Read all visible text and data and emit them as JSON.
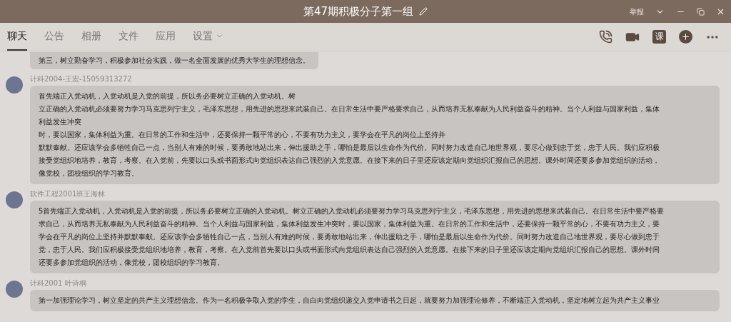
{
  "window": {
    "title": "第47期积极分子第一组",
    "report": "举报"
  },
  "tabs": [
    {
      "label": "聊天",
      "selected": true,
      "dropdown": false
    },
    {
      "label": "公告",
      "selected": false,
      "dropdown": false
    },
    {
      "label": "相册",
      "selected": false,
      "dropdown": false
    },
    {
      "label": "文件",
      "selected": false,
      "dropdown": false
    },
    {
      "label": "应用",
      "selected": false,
      "dropdown": false
    },
    {
      "label": "设置",
      "selected": false,
      "dropdown": true
    }
  ],
  "toolbar": {
    "lesson_label": "课"
  },
  "messages": [
    {
      "lines": [
        "第三，树立勤奋学习，积极参加社会实践，做一名全面发展的优秀大学生的理想信念。"
      ]
    },
    {
      "sender": "计科2004-王宏-15059313272",
      "lines": [
        "首先端正入党动机，入党动机是入党的前提，所以务必要树立正确的入党动机。树",
        "立正确的入党动机必须要努力学习马克思列宁主义，毛泽东思想，用先进的思想来武装自己。在日常生活中要严格要求自己，从而培养无私奉献为人民利益奋斗的精神。当个人利益与国家利益，集体",
        "利益发生冲突",
        "时，要以国家，集体利益为重。在日常的工作和生活中，还要保持一颗平常的心，不要有功力主义，要学会在平凡的岗位上坚持并",
        "默默奉献。还应该学会多牺牲自己一点，当别人有难的时候，要勇敢地站出来，伸出援助之手，哪怕是最后以生命作为代价。同时努力改造自己地世界观，要尽心做到忠于党，忠于人民。我们应积极",
        "接受党组织地培养，教育，考察。在入党前，先要以口头或书面形式向党组织表达自己强烈的入党意愿。在接下来的日子里还应该定期向党组织汇报自己的思想。课外时间还要多参加党组织的活动，",
        "像党校，团校组织的学习教育。"
      ]
    },
    {
      "sender": "软件工程2001班王海林",
      "lines": [
        "5首先端正入党动机，入党动机是入党的前提，所以务必要树立正确的入党动机。树立正确的入党动机必须要努力学习马克思列宁主义，毛泽东思想，用先进的思想来武装自己。在日常生活中要严格要",
        "求自己，从而培养无私奉献为人民利益奋斗的精神。当个人利益与国家利益，集体利益发生冲突时，要以国家，集体利益为重。在日常的工作和生活中，还要保持一颗平常的心，不要有功力主义，要",
        "学会在平凡的岗位上坚持并默默奉献。还应该学会多牺牲自己一点，当别人有难的时候，要勇敢地站出来，伸出援助之手，哪怕是最后以生命作为代价。同时努力改造自己地世界观，要尽心做到忠于",
        "党，忠于人民。我们应积极接受党组织地培养，教育，考察。在入党前首先要以口头或书面形式向党组织表达自己强烈的入党意愿。在接下来的日子里还应该定期向党组织汇报自己的思想。课外时间",
        "还要多参加党组织的活动，像党校，团校组织的学习教育。"
      ]
    },
    {
      "sender": "计科2001 叶诗桐",
      "lines": [
        "第一加强理论学习，树立坚定的共产主义理想信念。作为一名积极争取入党的学生，自白向党组织递交入党申请书之日起，就要努力加强理论修养，不断端正入党动机，坚定地树立起为共产主义事业"
      ]
    }
  ]
}
